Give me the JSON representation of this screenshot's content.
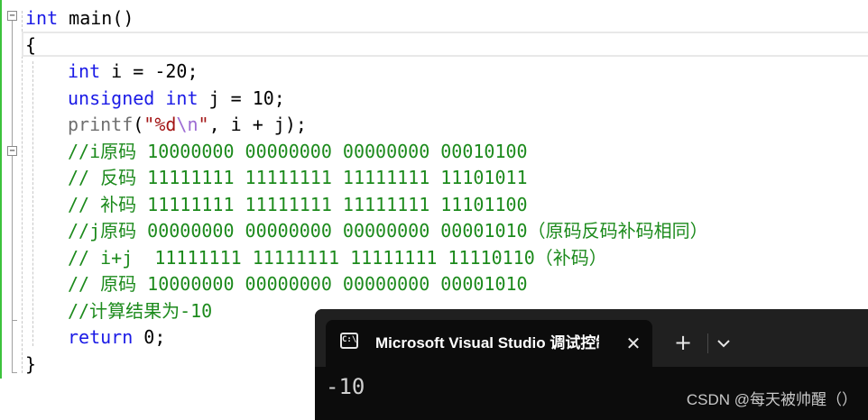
{
  "editor": {
    "lines": [
      {
        "parts": [
          {
            "t": "int",
            "c": "kw"
          },
          {
            "t": " main()",
            "c": ""
          }
        ]
      },
      {
        "parts": [
          {
            "t": "{",
            "c": ""
          }
        ]
      },
      {
        "parts": [
          {
            "t": "int",
            "c": "kw"
          },
          {
            "t": " i = -20;",
            "c": ""
          }
        ]
      },
      {
        "parts": [
          {
            "t": "unsigned",
            "c": "kw"
          },
          {
            "t": " ",
            "c": ""
          },
          {
            "t": "int",
            "c": "kw"
          },
          {
            "t": " j = 10;",
            "c": ""
          }
        ]
      },
      {
        "parts": [
          {
            "t": "printf",
            "c": "fn"
          },
          {
            "t": "(",
            "c": ""
          },
          {
            "t": "\"%d",
            "c": "str"
          },
          {
            "t": "\\n",
            "c": "esc"
          },
          {
            "t": "\"",
            "c": "str"
          },
          {
            "t": ", i + j);",
            "c": ""
          }
        ]
      },
      {
        "parts": [
          {
            "t": "//i原码 10000000 00000000 00000000 00010100",
            "c": "cm"
          }
        ]
      },
      {
        "parts": [
          {
            "t": "// 反码 11111111 11111111 11111111 11101011",
            "c": "cm"
          }
        ]
      },
      {
        "parts": [
          {
            "t": "// 补码 11111111 11111111 11111111 11101100",
            "c": "cm"
          }
        ]
      },
      {
        "parts": [
          {
            "t": "//j原码 00000000 00000000 00000000 00001010（原码反码补码相同）",
            "c": "cm"
          }
        ]
      },
      {
        "parts": [
          {
            "t": "// i+j  11111111 11111111 11111111 11110110（补码）",
            "c": "cm"
          }
        ]
      },
      {
        "parts": [
          {
            "t": "// 原码 10000000 00000000 00000000 00001010",
            "c": "cm"
          }
        ]
      },
      {
        "parts": [
          {
            "t": "//计算结果为-10",
            "c": "cm"
          }
        ]
      },
      {
        "parts": [
          {
            "t": "return",
            "c": "kw"
          },
          {
            "t": " 0;",
            "c": ""
          }
        ]
      },
      {
        "parts": [
          {
            "t": "}",
            "c": ""
          }
        ]
      }
    ],
    "fold_symbol": "−"
  },
  "console": {
    "tab_title": "Microsoft Visual Studio 调试控制台",
    "icon_glyph": "C:\\",
    "close_glyph": "✕",
    "new_tab_glyph": "+",
    "output": "-10",
    "watermark": "CSDN @每天被帅醒（）"
  },
  "colors": {
    "keyword": "#1a1ae6",
    "comment": "#1c8a1c",
    "string": "#a31515",
    "escape": "#9d6cd3",
    "console_bg": "#0c0c0c",
    "titlebar_bg": "#202020"
  }
}
